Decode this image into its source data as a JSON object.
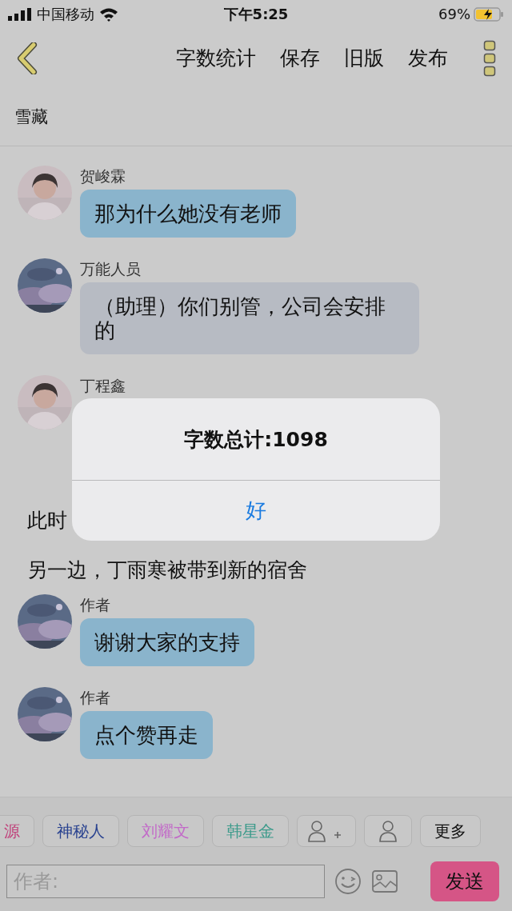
{
  "status_bar": {
    "carrier": "中国移动",
    "time": "下午5:25",
    "battery": "69%"
  },
  "nav": {
    "actions": [
      "字数统计",
      "保存",
      "旧版",
      "发布"
    ]
  },
  "title": "雪藏",
  "feed": [
    {
      "kind": "message",
      "name": "贺峻霖",
      "text": "那为什么她没有老师",
      "color": "#8ab4cc"
    },
    {
      "kind": "message",
      "name": "万能人员",
      "text": "（助理）你们别管，公司会安排的",
      "color": "#b7bbc3"
    },
    {
      "kind": "message",
      "name": "丁程鑫"
    },
    {
      "kind": "narration",
      "text": "此时"
    },
    {
      "kind": "narration",
      "text": "另一边，丁雨寒被带到新的宿舍"
    },
    {
      "kind": "message",
      "name": "作者",
      "text": "谢谢大家的支持",
      "color": "#8ab4cc"
    },
    {
      "kind": "message",
      "name": "作者",
      "text": "点个赞再走",
      "color": "#8ab4cc"
    }
  ],
  "roles": [
    {
      "kind": "name",
      "label": "源",
      "color": "#c0407a"
    },
    {
      "kind": "name",
      "label": "神秘人",
      "color": "#2a4390"
    },
    {
      "kind": "name",
      "label": "刘耀文",
      "color": "#c26ac8"
    },
    {
      "kind": "name",
      "label": "韩星金",
      "color": "#3a9a8a"
    },
    {
      "kind": "add-role"
    },
    {
      "kind": "role"
    },
    {
      "kind": "more",
      "label": "更多"
    }
  ],
  "composer": {
    "placeholder": "作者:",
    "send": "发送"
  },
  "alert": {
    "message": "字数总计:1098",
    "button": "好"
  }
}
